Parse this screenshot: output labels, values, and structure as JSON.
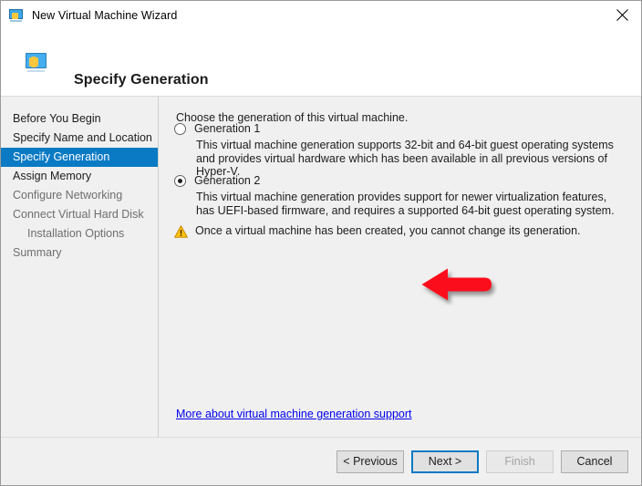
{
  "window": {
    "title": "New Virtual Machine Wizard",
    "title_icon": "virtual-machine-monitor-icon",
    "close_icon": "close-icon"
  },
  "header": {
    "title": "Specify Generation",
    "icon": "virtual-machine-monitor-icon"
  },
  "sidebar": {
    "items": [
      {
        "label": "Before You Begin",
        "state": "visited",
        "indent": false
      },
      {
        "label": "Specify Name and Location",
        "state": "visited",
        "indent": false
      },
      {
        "label": "Specify Generation",
        "state": "selected",
        "indent": false
      },
      {
        "label": "Assign Memory",
        "state": "visited",
        "indent": false
      },
      {
        "label": "Configure Networking",
        "state": "upcoming",
        "indent": false
      },
      {
        "label": "Connect Virtual Hard Disk",
        "state": "upcoming",
        "indent": false
      },
      {
        "label": "Installation Options",
        "state": "upcoming",
        "indent": true
      },
      {
        "label": "Summary",
        "state": "upcoming",
        "indent": false
      }
    ]
  },
  "main": {
    "intro": "Choose the generation of this virtual machine.",
    "options": [
      {
        "label": "Generation 1",
        "selected": false,
        "description": "This virtual machine generation supports 32-bit and 64-bit guest operating systems and provides virtual hardware which has been available in all previous versions of Hyper-V."
      },
      {
        "label": "Generation 2",
        "selected": true,
        "description": "This virtual machine generation provides support for newer virtualization features, has UEFI-based firmware, and requires a supported 64-bit guest operating system."
      }
    ],
    "warning": {
      "icon": "warning-triangle-icon",
      "text": "Once a virtual machine has been created, you cannot change its generation."
    },
    "link": {
      "label": "More about virtual machine generation support",
      "color": "#0000ee"
    },
    "annotation": {
      "type": "red-arrow-left",
      "color": "#fc0d1b",
      "points_at": "Generation 2"
    }
  },
  "footer": {
    "buttons": [
      {
        "label": "< Previous",
        "state": "enabled"
      },
      {
        "label": "Next >",
        "state": "default"
      },
      {
        "label": "Finish",
        "state": "disabled"
      },
      {
        "label": "Cancel",
        "state": "enabled"
      }
    ]
  },
  "colors": {
    "accent": "#0a7ac4",
    "window_bg": "#f0f0f0",
    "header_bg": "#ffffff",
    "link": "#0000ee",
    "annotation_red": "#fc0d1b",
    "warning_amber": "#ffc20e"
  }
}
